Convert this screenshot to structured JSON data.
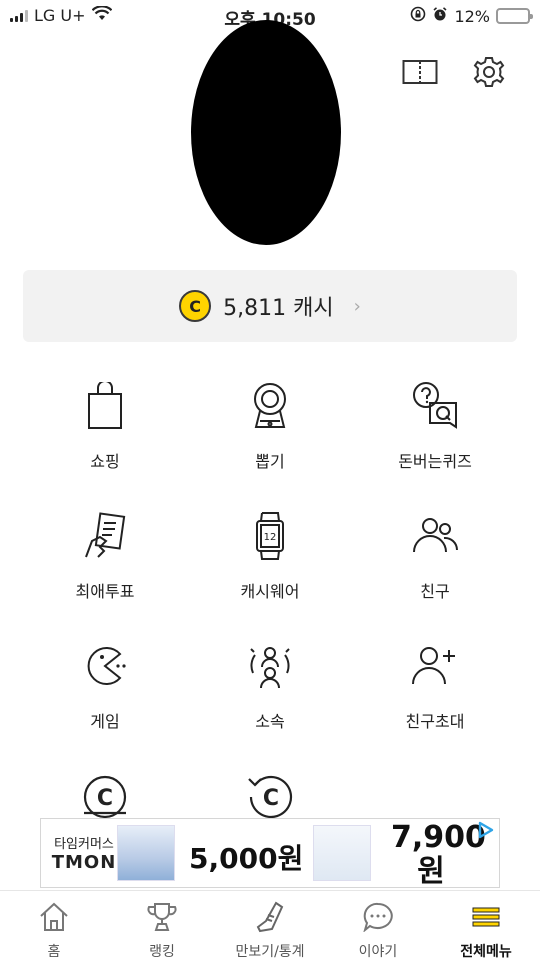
{
  "status_bar": {
    "carrier": "LG U+",
    "time": "오후 10:50",
    "battery_percent": "12%",
    "battery_level": 0.12
  },
  "cash": {
    "coin_symbol": "C",
    "amount": "5,811 캐시",
    "chevron": "›"
  },
  "menu": [
    {
      "label": "쇼핑",
      "icon": "shopping-bag-icon"
    },
    {
      "label": "뽑기",
      "icon": "gacha-machine-icon"
    },
    {
      "label": "돈버는퀴즈",
      "icon": "quiz-icon"
    },
    {
      "label": "최애투표",
      "icon": "vote-icon"
    },
    {
      "label": "캐시웨어",
      "icon": "smartwatch-icon",
      "icon_text": "12"
    },
    {
      "label": "친구",
      "icon": "friends-icon"
    },
    {
      "label": "게임",
      "icon": "pacman-icon"
    },
    {
      "label": "소속",
      "icon": "group-icon"
    },
    {
      "label": "친구초대",
      "icon": "add-friend-icon"
    },
    {
      "label": "",
      "icon": "coin-history-icon"
    },
    {
      "label": "",
      "icon": "cash-refresh-icon"
    }
  ],
  "ad": {
    "brand_line1": "타임커머스",
    "brand_line2": "TMON",
    "price1": "5,000원",
    "price2_line1": "7,900",
    "price2_line2": "원"
  },
  "bottom_nav": [
    {
      "label": "홈",
      "icon": "home-icon",
      "active": false
    },
    {
      "label": "랭킹",
      "icon": "trophy-icon",
      "active": false
    },
    {
      "label": "만보기/통계",
      "icon": "shoe-icon",
      "active": false
    },
    {
      "label": "이야기",
      "icon": "chat-icon",
      "active": false
    },
    {
      "label": "전체메뉴",
      "icon": "menu-icon",
      "active": true
    }
  ],
  "colors": {
    "accent_yellow": "#ffd400",
    "text": "#222222",
    "panel_bg": "#f2f2f2"
  }
}
